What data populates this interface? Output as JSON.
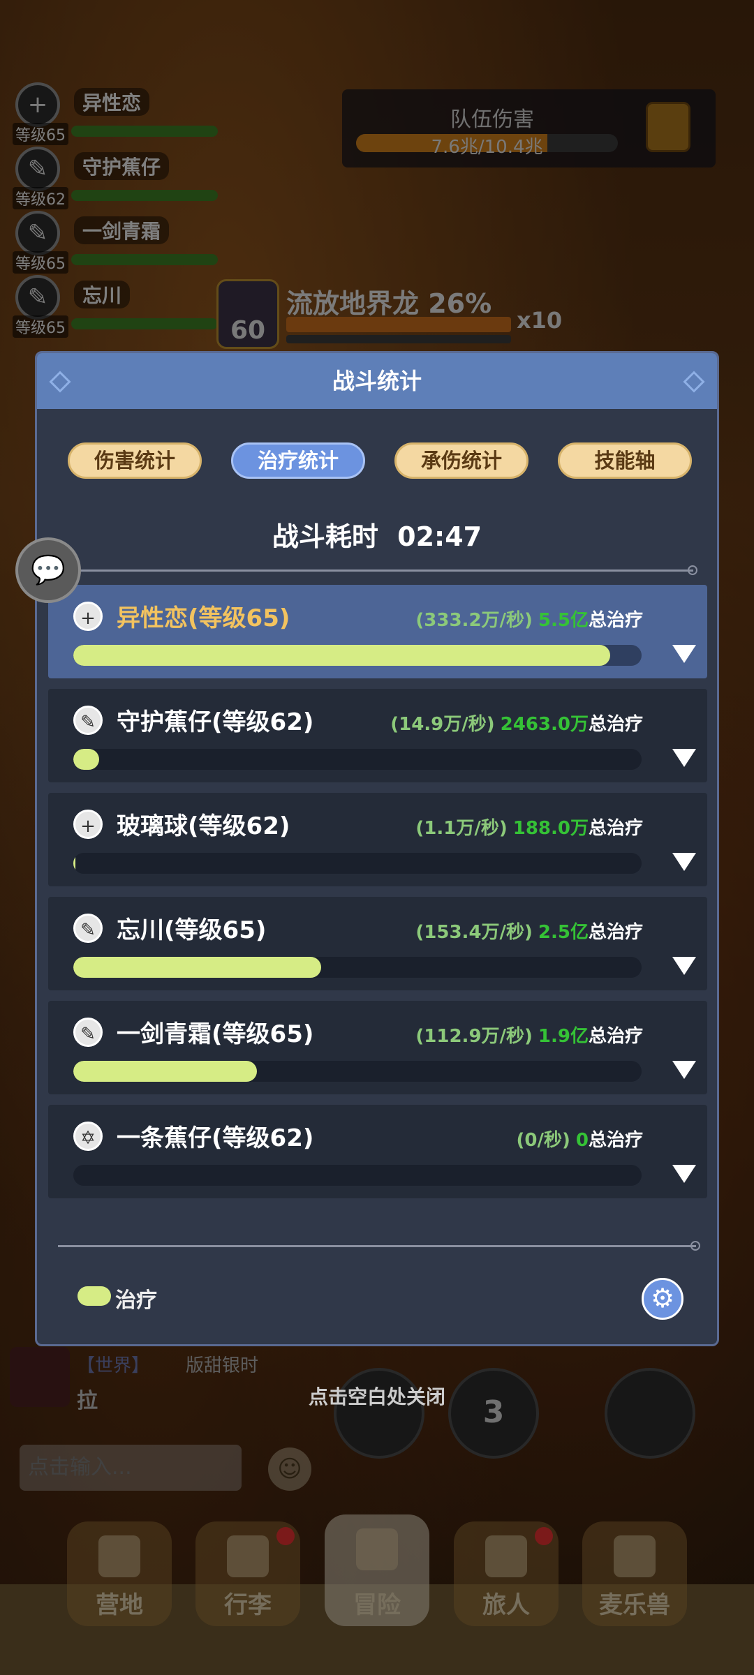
{
  "scene": {
    "party": [
      {
        "name": "异性恋",
        "level": "等级65",
        "icon": "+"
      },
      {
        "name": "守护蕉仔",
        "level": "等级62",
        "icon": "✎"
      },
      {
        "name": "一剑青霜",
        "level": "等级65",
        "icon": "✎"
      },
      {
        "name": "忘川",
        "level": "等级65",
        "icon": "✎"
      }
    ],
    "team_damage": {
      "title": "队伍伤害",
      "value": "7.6兆/10.4兆"
    },
    "boss": {
      "name": "流放地界龙 26%",
      "level": "60",
      "multiplier": "x10"
    },
    "world_chat": {
      "channel": "【世界】",
      "sender": "版甜银时",
      "message": "拉"
    },
    "chat_input_placeholder": "点击输入...",
    "skill_number": "3",
    "close_hint": "点击空白处关闭",
    "nav": [
      "营地",
      "行李",
      "冒险",
      "旅人",
      "麦乐兽"
    ]
  },
  "dialog": {
    "title": "战斗统计",
    "tabs": [
      "伤害统计",
      "治疗统计",
      "承伤统计",
      "技能轴"
    ],
    "active_tab": 1,
    "duration_label": "战斗耗时",
    "duration": "02:47",
    "rows": [
      {
        "name": "异性恋(等级65)",
        "icon": "+",
        "rate": "(333.2万/秒)",
        "total": "5.5亿",
        "suffix": "总治疗",
        "fraction": 0.945
      },
      {
        "name": "守护蕉仔(等级62)",
        "icon": "✎",
        "rate": "(14.9万/秒)",
        "total": "2463.0万",
        "suffix": "总治疗",
        "fraction": 0.045
      },
      {
        "name": "玻璃球(等级62)",
        "icon": "+",
        "rate": "(1.1万/秒)",
        "total": "188.0万",
        "suffix": "总治疗",
        "fraction": 0.004
      },
      {
        "name": "忘川(等级65)",
        "icon": "✎",
        "rate": "(153.4万/秒)",
        "total": "2.5亿",
        "suffix": "总治疗",
        "fraction": 0.436
      },
      {
        "name": "一剑青霜(等级65)",
        "icon": "✎",
        "rate": "(112.9万/秒)",
        "total": "1.9亿",
        "suffix": "总治疗",
        "fraction": 0.323
      },
      {
        "name": "一条蕉仔(等级62)",
        "icon": "✡",
        "rate": "(0/秒)",
        "total": "0",
        "suffix": "总治疗",
        "fraction": 0
      }
    ],
    "legend_label": "治疗",
    "colors": {
      "header": "#5e7fb8",
      "bar_fill": "#d6ec85",
      "total_green": "#35c236",
      "active_tab": "#6c93e0"
    }
  }
}
